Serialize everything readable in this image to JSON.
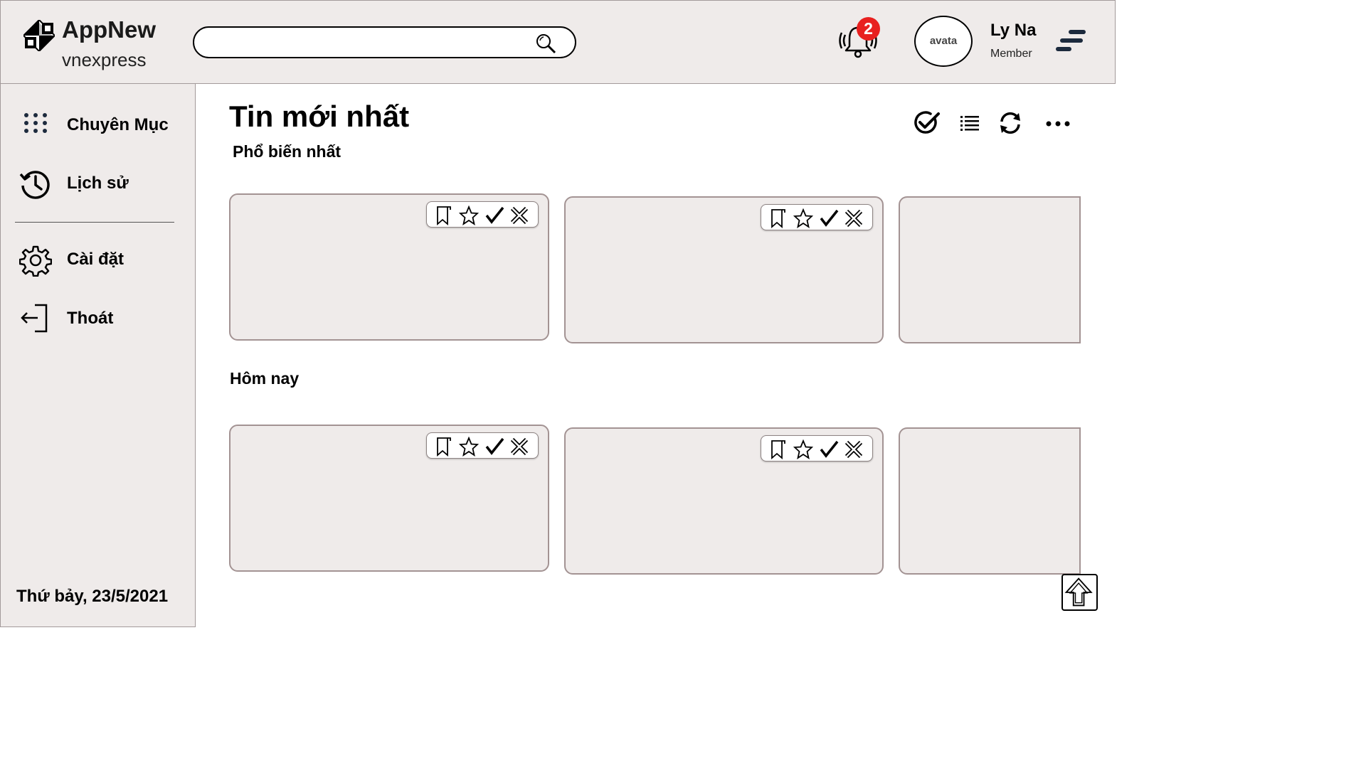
{
  "app": {
    "name": "AppNew",
    "subtitle": "vnexpress"
  },
  "search": {
    "value": "",
    "placeholder": ""
  },
  "notifications": {
    "count": "2"
  },
  "user": {
    "avatar_text": "avata",
    "name": "Ly Na",
    "role": "Member"
  },
  "sidebar": {
    "items": [
      {
        "label": "Chuyên Mục",
        "icon": "grid-dots-icon"
      },
      {
        "label": "Lịch sử",
        "icon": "history-icon"
      },
      {
        "label": "Cài đặt",
        "icon": "gear-icon"
      },
      {
        "label": "Thoát",
        "icon": "logout-icon"
      }
    ],
    "date": "Thứ bảy, 23/5/2021"
  },
  "main": {
    "title": "Tin mới nhất",
    "toolbar": [
      "check-circle-icon",
      "list-icon",
      "refresh-icon",
      "more-icon"
    ],
    "sections": [
      {
        "title": "Phổ biến nhất",
        "cards": 3
      },
      {
        "title": "Hôm nay",
        "cards": 3
      }
    ],
    "card_actions": [
      "bookmark-icon",
      "star-icon",
      "check-icon",
      "close-icon"
    ]
  },
  "colors": {
    "panel_bg": "#efebea",
    "card_border": "#a39393",
    "badge": "#e8201f",
    "menu_icon": "#1c2a3d"
  }
}
